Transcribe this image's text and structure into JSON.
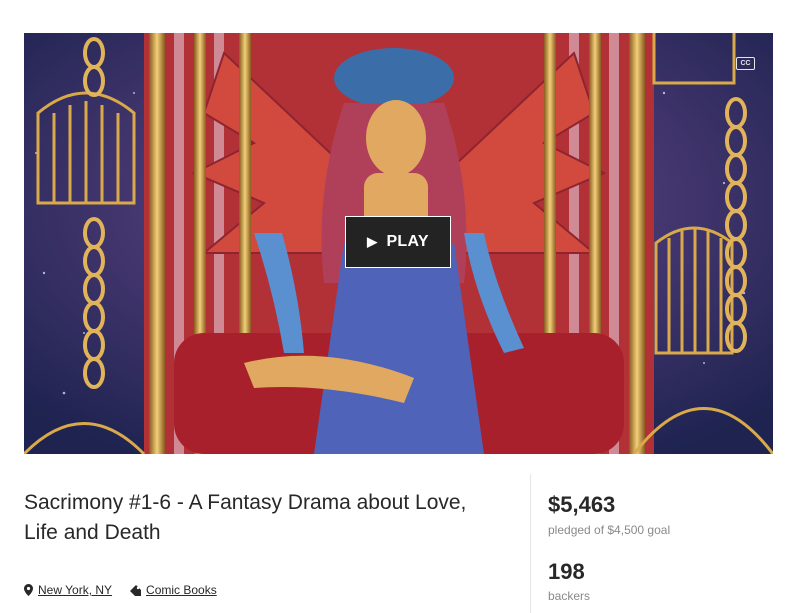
{
  "video": {
    "play_label": "PLAY",
    "cc_label": "CC"
  },
  "project": {
    "title": "Sacrimony #1-6 - A Fantasy Drama about Love, Life and Death",
    "location": "New York, NY",
    "category": "Comic Books"
  },
  "stats": {
    "pledged_amount": "$5,463",
    "pledged_label": "pledged of $4,500 goal",
    "backers_count": "198",
    "backers_label": "backers"
  },
  "colors": {
    "video_night_sky": "#2a2e5a",
    "cage_gold": "#d9a94a",
    "curtain_red": "#c93a3a",
    "figure_blue": "#5a8fd0",
    "text_primary": "#282828",
    "text_secondary": "#8a8a8a"
  }
}
